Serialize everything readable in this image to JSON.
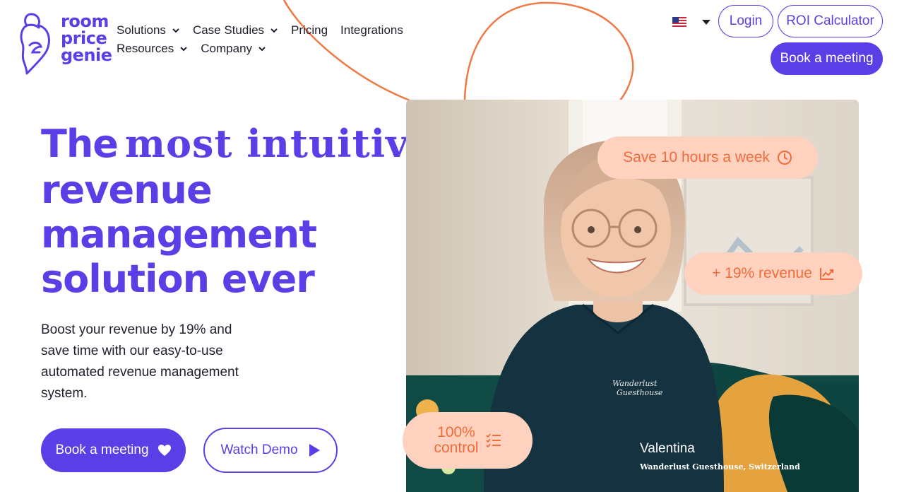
{
  "brand": {
    "line1": "room",
    "line2": "price",
    "line3": "genie",
    "color": "#5b3fe6",
    "accent": "#f26b3a",
    "pill_bg": "#ffd2bf"
  },
  "nav": {
    "items": [
      {
        "label": "Solutions",
        "has_dropdown": true
      },
      {
        "label": "Case Studies",
        "has_dropdown": true
      },
      {
        "label": "Pricing",
        "has_dropdown": false
      },
      {
        "label": "Integrations",
        "has_dropdown": false
      },
      {
        "label": "Resources",
        "has_dropdown": true
      },
      {
        "label": "Company",
        "has_dropdown": true
      }
    ]
  },
  "header": {
    "language_icon": "us-flag-icon",
    "login_label": "Login",
    "roi_label": "ROI Calculator",
    "book_label": "Book a meeting"
  },
  "hero": {
    "headline_the": "The",
    "headline_serif": "most intuitive",
    "headline_2": "revenue",
    "headline_3": "management",
    "headline_4": "solution ever",
    "subtext": "Boost your revenue by 19% and save time with our easy-to-use automated revenue management system.",
    "book_label": "Book a meeting",
    "book_icon": "heart-icon",
    "watch_label": "Watch Demo",
    "watch_icon": "play-icon"
  },
  "photo": {
    "person_name": "Valentina",
    "person_place": "Wanderlust Guesthouse, Switzerland",
    "shirt_text_1": "Wanderlust",
    "shirt_text_2": "Guesthouse"
  },
  "pills": {
    "save": {
      "label": "Save 10 hours a week",
      "icon": "clock-icon"
    },
    "revenue": {
      "label": "+ 19% revenue",
      "icon": "chart-icon"
    },
    "control": {
      "line1": "100%",
      "line2": "control",
      "icon": "checklist-icon"
    }
  }
}
